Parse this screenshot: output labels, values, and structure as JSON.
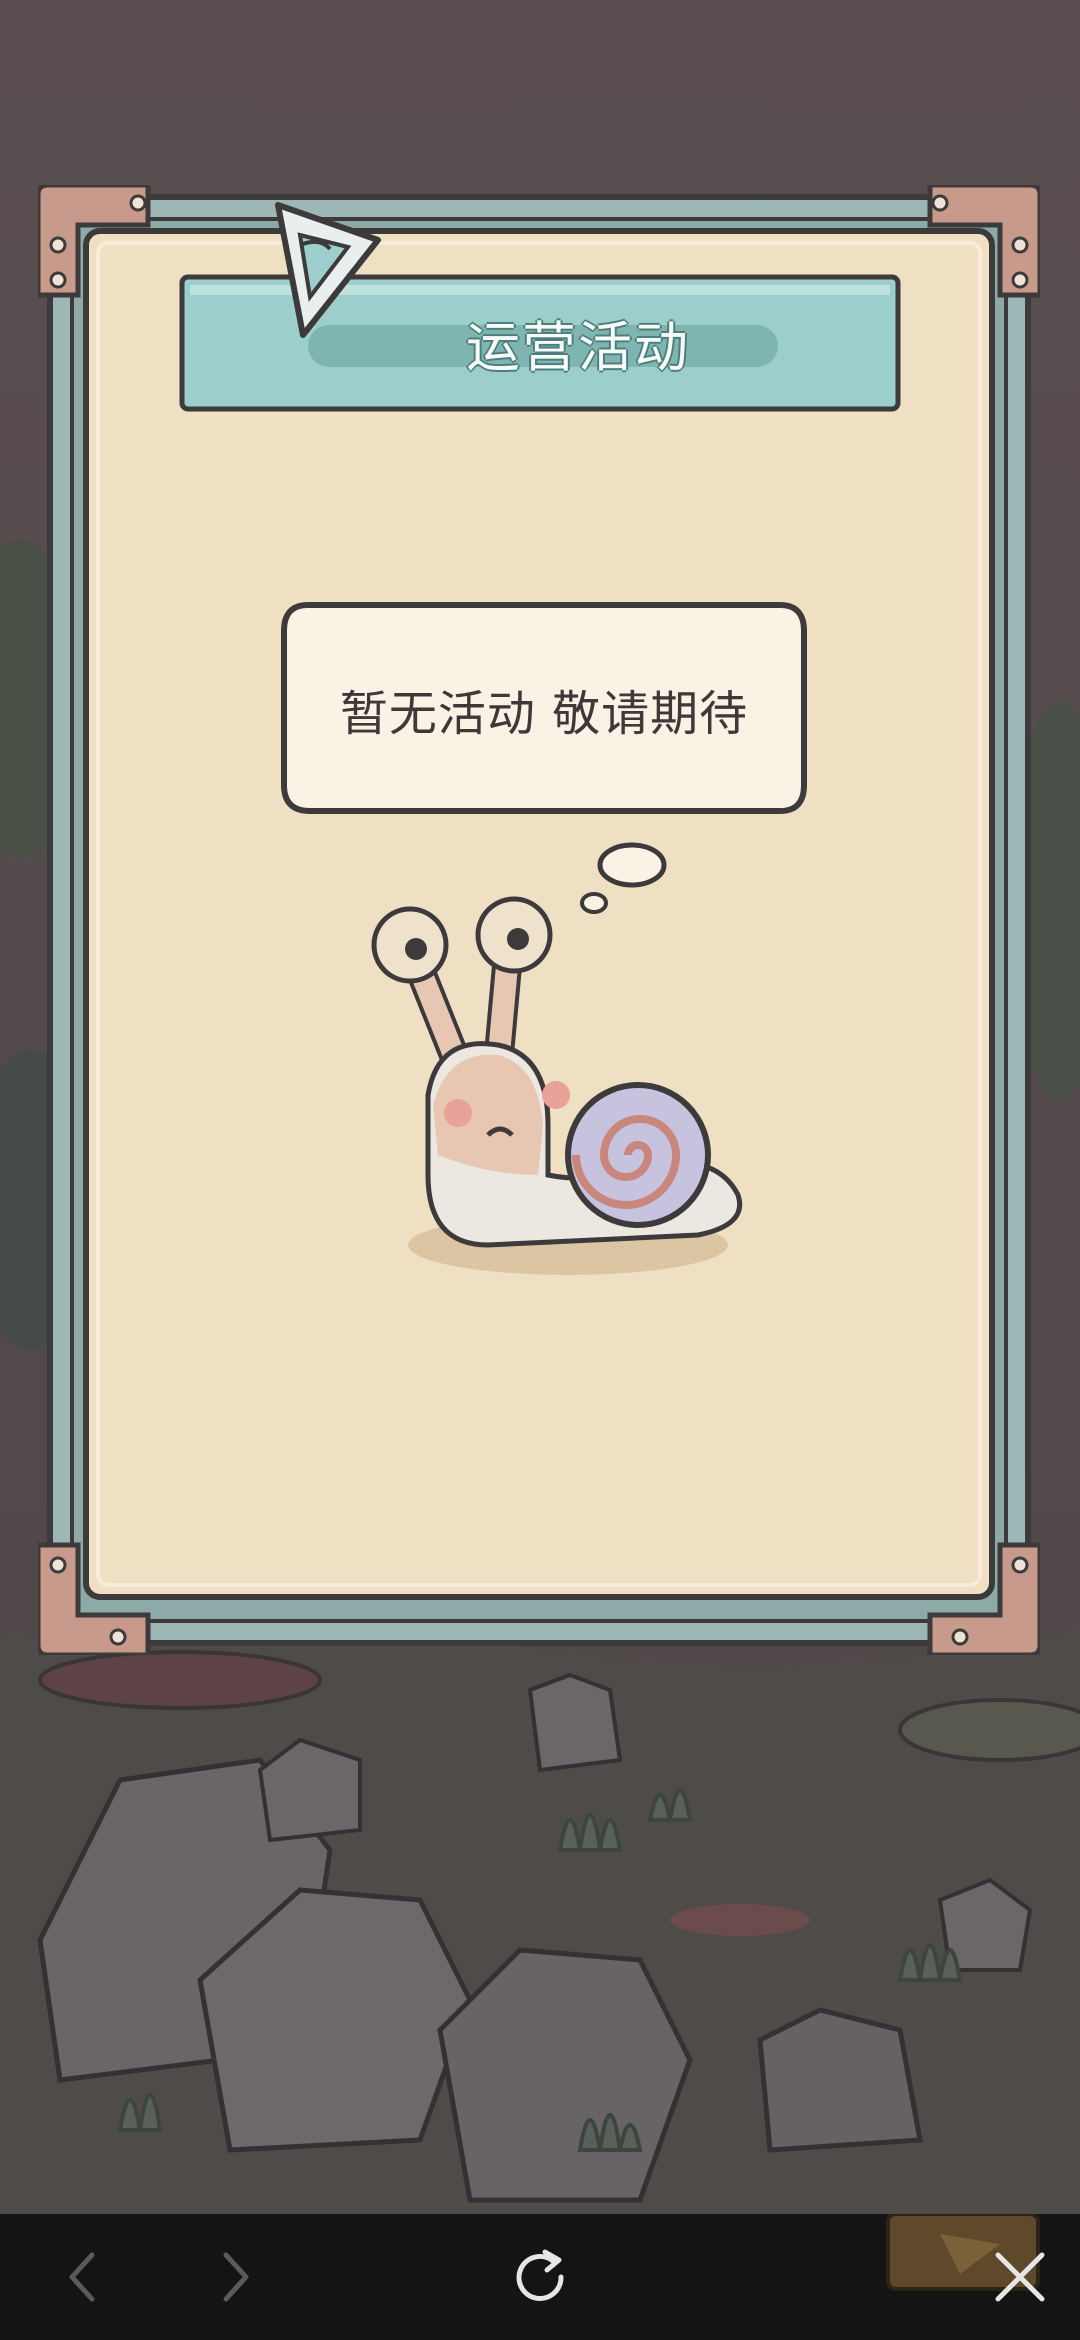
{
  "dialog": {
    "title": "运营活动",
    "message": "暂无活动 敬请期待",
    "icon": "triangle-rune-icon",
    "character": "snail"
  },
  "navbar": {
    "back_icon": "chevron-left-icon",
    "forward_icon": "chevron-right-icon",
    "refresh_icon": "refresh-icon",
    "close_icon": "close-icon"
  },
  "colors": {
    "frame": "#9cb7b5",
    "frame_dark": "#3c3a3a",
    "corner": "#c79a8c",
    "paper": "#efdfc3",
    "title_bar": "#9ccfcb",
    "navbar": "#141414"
  }
}
